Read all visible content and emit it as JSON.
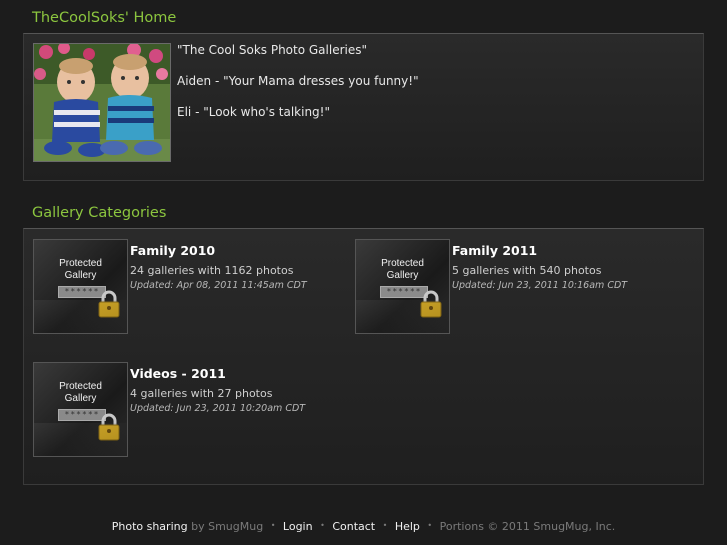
{
  "home": {
    "title": "TheCoolSoks' Home",
    "lines": [
      "\"The Cool Soks Photo Galleries\"",
      "Aiden - \"Your Mama dresses you funny!\"",
      "Eli - \"Look who's talking!\""
    ]
  },
  "categories": {
    "title": "Gallery Categories",
    "protected_label_line1": "Protected",
    "protected_label_line2": "Gallery",
    "password_mask": "******",
    "items": [
      {
        "title": "Family 2010",
        "count": "24 galleries with 1162 photos",
        "updated": "Updated: Apr 08, 2011 11:45am CDT"
      },
      {
        "title": "Family 2011",
        "count": "5 galleries with 540 photos",
        "updated": "Updated: Jun 23, 2011 10:16am CDT"
      },
      {
        "title": "Videos - 2011",
        "count": "4 galleries with 27 photos",
        "updated": "Updated: Jun 23, 2011 10:20am CDT"
      }
    ]
  },
  "footer": {
    "photo_sharing": "Photo sharing",
    "by": "by SmugMug",
    "login": "Login",
    "contact": "Contact",
    "help": "Help",
    "portions": "Portions © 2011 SmugMug, Inc."
  },
  "colors": {
    "accent": "#8cc63f",
    "background": "#1c1c1c"
  }
}
